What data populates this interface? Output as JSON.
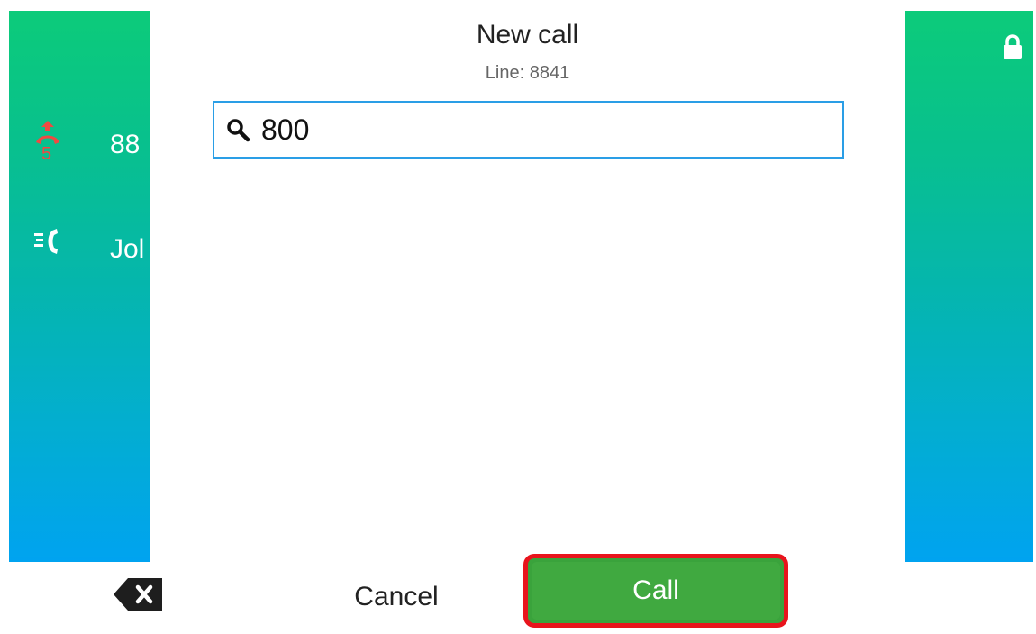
{
  "dialog": {
    "title": "New call",
    "subtitle": "Line: 8841"
  },
  "search": {
    "value": "800",
    "icon": "search-icon"
  },
  "background_lines": [
    {
      "icon": "missed-call-icon",
      "badge": "5",
      "label": "88"
    },
    {
      "icon": "outgoing-call-icon",
      "label": "Jol"
    }
  ],
  "status": {
    "icon": "lock-icon"
  },
  "softkeys": {
    "backspace_icon": "backspace-icon",
    "cancel_label": "Cancel",
    "call_label": "Call"
  },
  "colors": {
    "panel_top": "#0ccb7a",
    "panel_bottom": "#00a3f0",
    "search_border": "#2a9ee6",
    "call_button": "#40a940",
    "highlight": "#e8141c",
    "missed_badge": "#ee4a42"
  }
}
